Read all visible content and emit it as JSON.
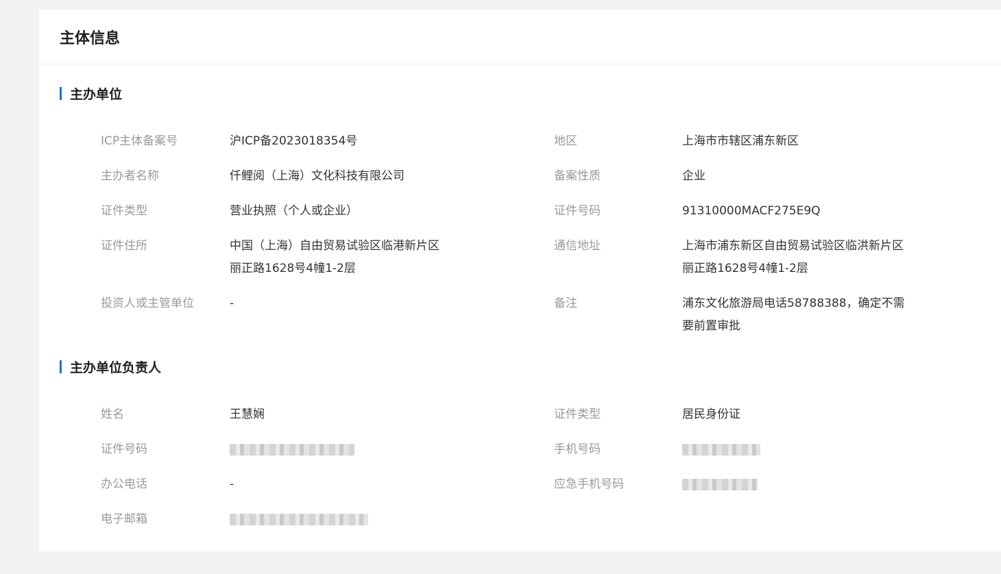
{
  "page": {
    "title": "主体信息"
  },
  "organizer": {
    "section_title": "主办单位",
    "rows": [
      {
        "label": "ICP主体备案号",
        "value": "沪ICP备2023018354号"
      },
      {
        "label": "地区",
        "value": "上海市市辖区浦东新区"
      },
      {
        "label": "主办者名称",
        "value": "仟鲤阅（上海）文化科技有限公司"
      },
      {
        "label": "备案性质",
        "value": "企业"
      },
      {
        "label": "证件类型",
        "value": "营业执照（个人或企业）"
      },
      {
        "label": "证件号码",
        "value": "91310000MACF275E9Q"
      },
      {
        "label": "证件住所",
        "value": "中国（上海）自由贸易试验区临港新片区丽正路1628号4幢1-2层"
      },
      {
        "label": "通信地址",
        "value": "上海市浦东新区自由贸易试验区临洪新片区丽正路1628号4幢1-2层"
      },
      {
        "label": "投资人或主管单位",
        "value": "-"
      },
      {
        "label": "备注",
        "value": "浦东文化旅游局电话58788388，确定不需要前置审批"
      }
    ]
  },
  "principal": {
    "section_title": "主办单位负责人",
    "rows": [
      {
        "label": "姓名",
        "value": "王慧娴"
      },
      {
        "label": "证件类型",
        "value": "居民身份证"
      },
      {
        "label": "证件号码",
        "value": ""
      },
      {
        "label": "手机号码",
        "value": ""
      },
      {
        "label": "办公电话",
        "value": "-"
      },
      {
        "label": "应急手机号码",
        "value": ""
      },
      {
        "label": "电子邮箱",
        "value": ""
      }
    ]
  }
}
